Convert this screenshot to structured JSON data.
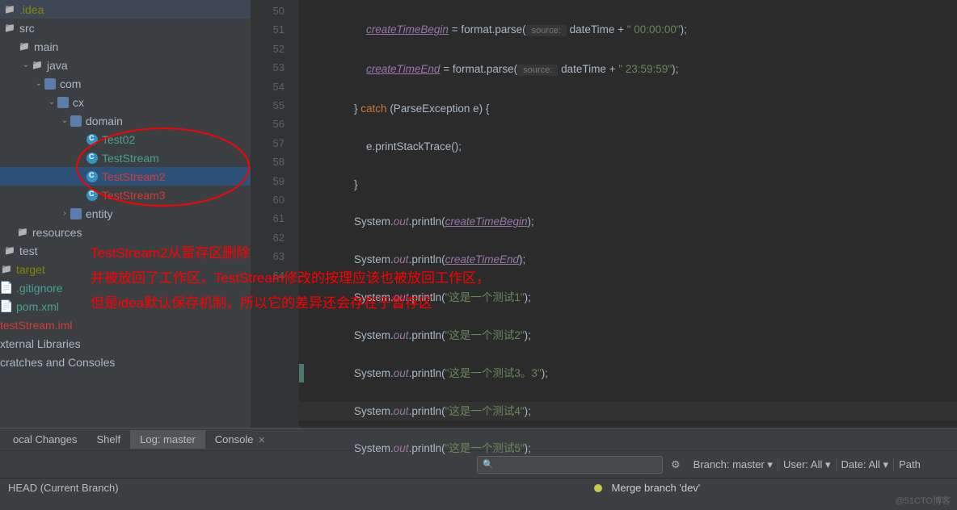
{
  "tree": {
    "idea": ".idea",
    "src": "src",
    "main": "main",
    "java": "java",
    "com": "com",
    "cx": "cx",
    "domain": "domain",
    "test02": "Test02",
    "teststream": "TestStream",
    "teststream2": "TestStream2",
    "teststream3": "TestStream3",
    "entity": "entity",
    "resources": "resources",
    "test": "test",
    "target": "target",
    "gitignore": ".gitignore",
    "pom": "pom.xml",
    "iml": "testStream.iml",
    "extlib": "xternal Libraries",
    "scratch": "cratches and Consoles"
  },
  "gutter": [
    "50",
    "51",
    "52",
    "53",
    "54",
    "55",
    "56",
    "57",
    "58",
    "59",
    "60",
    "61",
    "62",
    "63",
    "64"
  ],
  "code": {
    "l50": {
      "var": "createTimeBegin",
      "eq": " = format.parse(",
      "hint": " source: ",
      "arg": "dateTime + ",
      "str": "\" 00:00:00\"",
      "end": ");"
    },
    "l51": {
      "var": "createTimeEnd",
      "eq": " = format.parse(",
      "hint": " source: ",
      "arg": "dateTime + ",
      "str": "\" 23:59:59\"",
      "end": ");"
    },
    "l52": {
      "brace": "} ",
      "catch": "catch ",
      "rest": "(ParseException e) {"
    },
    "l53": "e.printStackTrace();",
    "l54": "}",
    "l55": {
      "pre": "System.",
      "out": "out",
      "mid": ".println(",
      "arg": "createTimeBegin",
      "end": ");"
    },
    "l56": {
      "pre": "System.",
      "out": "out",
      "mid": ".println(",
      "arg": "createTimeEnd",
      "end": ");"
    },
    "l57": {
      "pre": "System.",
      "out": "out",
      "mid": ".println(",
      "str": "\"这是一个测试1\"",
      "end": ");"
    },
    "l58": {
      "pre": "System.",
      "out": "out",
      "mid": ".println(",
      "str": "\"这是一个测试2\"",
      "end": ");"
    },
    "l59": {
      "pre": "System.",
      "out": "out",
      "mid": ".println(",
      "str": "\"这是一个测试3。3\"",
      "end": ");"
    },
    "l60": {
      "pre": "System.",
      "out": "out",
      "mid": ".println(",
      "str": "\"这是一个测试4\"",
      "end": ");"
    },
    "l61": {
      "pre": "System.",
      "out": "out",
      "mid": ".println(",
      "str": "\"这是一个测试5\"",
      "end": ");"
    }
  },
  "annotations": {
    "line1": "TestStream2从暂存区删除",
    "line2": "并被放回了工作区，TestStream修改的按理应该也被放回工作区，",
    "line3": "但是idea默认保存机制，所以它的差异还会存在于暂存区"
  },
  "tabs": {
    "local": "ocal Changes",
    "shelf": "Shelf",
    "log": "Log: master",
    "console": "Console"
  },
  "log": {
    "search_ph": "",
    "branch": "Branch: master",
    "user": "User: All",
    "date": "Date: All",
    "path": "Path",
    "head": "HEAD (Current Branch)",
    "commit": "Merge branch 'dev'"
  },
  "watermark": "@51CTO博客"
}
